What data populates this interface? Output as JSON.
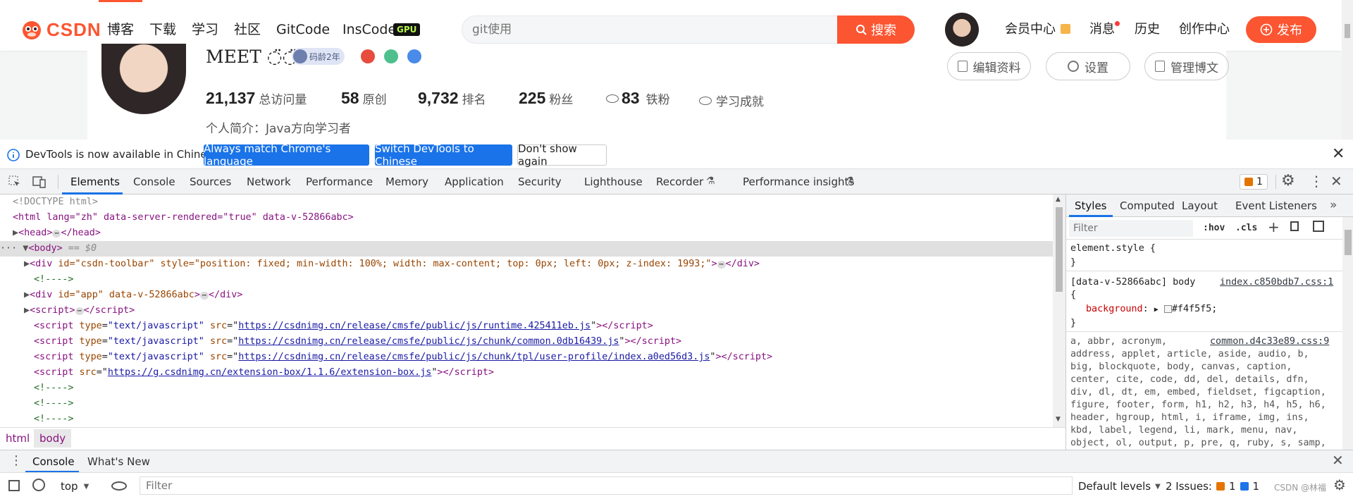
{
  "toolbar": {
    "logo": "CSDN",
    "nav": [
      "博客",
      "下载",
      "学习",
      "社区",
      "GitCode",
      "InsCode"
    ],
    "gpu_badge": "GPU",
    "search_placeholder": "git使用",
    "search_button": "搜索",
    "right": [
      "会员中心",
      "消息",
      "历史",
      "创作中心"
    ],
    "publish": "发布"
  },
  "profile": {
    "name": "MEET ◌̈◌̈ .",
    "badge": "码龄2年",
    "buttons": [
      "编辑资料",
      "设置",
      "管理博文"
    ],
    "stats": [
      {
        "value": "21,137",
        "label": "总访问量"
      },
      {
        "value": "58",
        "label": "原创"
      },
      {
        "value": "9,732",
        "label": "排名"
      },
      {
        "value": "225",
        "label": "粉丝"
      },
      {
        "value": "83",
        "label": "铁粉"
      }
    ],
    "achievement": "学习成就",
    "bio": "个人简介：Java方向学习者"
  },
  "infobar": {
    "message": "DevTools is now available in Chinese!",
    "btn1": "Always match Chrome's language",
    "btn2": "Switch DevTools to Chinese",
    "btn3": "Don't show again"
  },
  "devtools": {
    "tabs": [
      "Elements",
      "Console",
      "Sources",
      "Network",
      "Performance",
      "Memory",
      "Application",
      "Security",
      "Lighthouse",
      "Recorder",
      "Performance insights"
    ],
    "issues_count": "1"
  },
  "elements": {
    "doctype": "<!DOCTYPE html>",
    "html_open": "<html lang=\"zh\" data-server-rendered=\"true\" data-v-52866abc>",
    "head": "<head>",
    "head_close": "</head>",
    "body": "<body>",
    "body_suffix": " == $0",
    "toolbar_div_attrs": "id=\"csdn-toolbar\" style=\"position: fixed; min-width: 100%; width: max-content; top: 0px; left: 0px; z-index: 1993;\"",
    "comment": "<!---->",
    "app_div_attrs": "id=\"app\" data-v-52866abc",
    "script_srcs": [
      "https://csdnimg.cn/release/cmsfe/public/js/runtime.425411eb.js",
      "https://csdnimg.cn/release/cmsfe/public/js/chunk/common.0db16439.js",
      "https://csdnimg.cn/release/cmsfe/public/js/chunk/tpl/user-profile/index.a0ed56d3.js",
      "https://g.csdnimg.cn/extension-box/1.1.6/extension-box.js"
    ]
  },
  "breadcrumb": [
    "html",
    "body"
  ],
  "styles": {
    "tabs": [
      "Styles",
      "Computed",
      "Layout",
      "Event Listeners"
    ],
    "filter_placeholder": "Filter",
    "hov": ":hov",
    "cls": ".cls",
    "element_style": "element.style {",
    "close_brace": "}",
    "rule1_selector": "[data-v-52866abc] body",
    "rule1_source": "index.c850bdb7.css:1",
    "open_brace": "{",
    "rule1_prop": "background",
    "rule1_value": "#f4f5f5;",
    "rule2_source": "common.d4c33e89.css:9",
    "rule2_lines": [
      "a, abbr, acronym,",
      "address, applet, article, aside, audio, b,",
      "big, blockquote, body, canvas, caption,",
      "center, cite, code, dd, del, details, dfn,",
      "div, dl, dt, em, embed, fieldset, figcaption,",
      "figure, footer, form, h1, h2, h3, h4, h5, h6,",
      "header, hgroup, html, i, iframe, img, ins,",
      "kbd, label, legend, li, mark, menu, nav,",
      "object, ol, output, p, pre, q, ruby, s, samp,"
    ]
  },
  "drawer": {
    "tabs": [
      "Console",
      "What's New"
    ]
  },
  "console": {
    "context": "top",
    "filter_placeholder": "Filter",
    "levels": "Default levels",
    "issues_label": "2 Issues:",
    "issues_warn": "1",
    "issues_info": "1",
    "watermark": "CSDN @林福"
  },
  "colors": {
    "brand": "#fc5531",
    "devtools_blue": "#1a73e8",
    "body_bg": "#f4f5f5"
  }
}
